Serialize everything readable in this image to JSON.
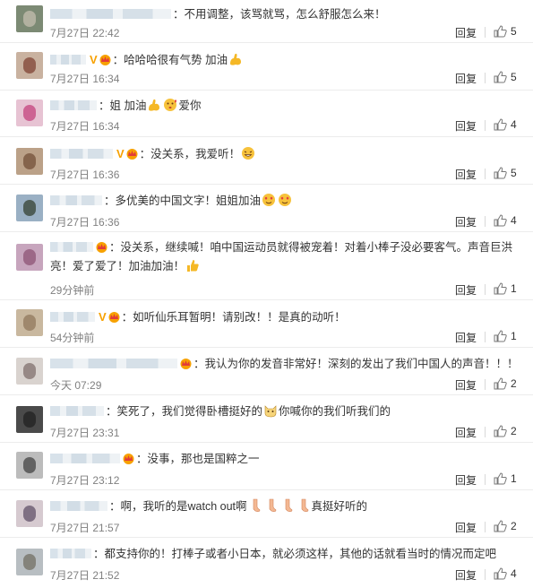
{
  "ui": {
    "reply_label": "回复"
  },
  "comments": [
    {
      "text": "：不用调整，该骂就骂，怎么舒服怎么来！",
      "time": "7月27日 22:42",
      "likes": "5"
    },
    {
      "text": "：哈哈哈很有气势 加油",
      "time": "7月27日 16:34",
      "likes": "5"
    },
    {
      "text": "：姐 加油",
      "text2": "爱你",
      "time": "7月27日 16:34",
      "likes": "4"
    },
    {
      "text": "：没关系，我爱听！",
      "time": "7月27日 16:36",
      "likes": "5"
    },
    {
      "text": "：多优美的中国文字！姐姐加油",
      "time": "7月27日 16:36",
      "likes": "4"
    },
    {
      "text": "：没关系，继续喊！咱中国运动员就得被宠着！对着小棒子没必要客气。声音巨洪亮！爱了爱了！加油加油！",
      "time": "29分钟前",
      "likes": "1"
    },
    {
      "text": "：如听仙乐耳暂明！请别改！！是真的动听！",
      "time": "54分钟前",
      "likes": "1"
    },
    {
      "text": "：我认为你的发音非常好！深刻的发出了我们中国人的声音！！！",
      "time": "今天 07:29",
      "likes": "2"
    },
    {
      "text": "：笑死了，我们觉得卧槽挺好的",
      "text2": "你喊你的我们听我们的",
      "time": "7月27日 23:31",
      "likes": "2"
    },
    {
      "text": "：没事，那也是国粹之一",
      "time": "7月27日 23:12",
      "likes": "1"
    },
    {
      "text": "：啊，我听的是watch out啊",
      "text2": "真挺好听的",
      "time": "7月27日 21:57",
      "likes": "2"
    },
    {
      "text": "：都支持你的！打棒子或者小日本，就必须这样，其他的话就看当时的情况而定吧",
      "time": "7月27日 21:52",
      "likes": "4"
    }
  ],
  "colors": {
    "accent_vip": "#f7a100",
    "link": "#333333",
    "meta": "#808080"
  },
  "icons": {
    "like": "thumbs-up-icon",
    "crown": "vip-crown-icon",
    "vbadge": "V"
  }
}
